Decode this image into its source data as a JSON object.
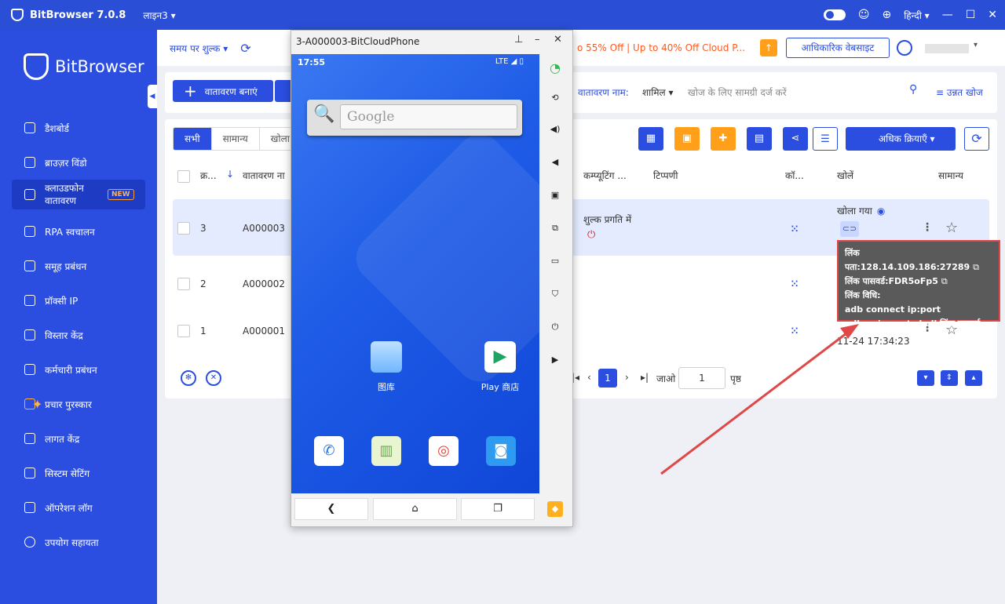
{
  "titlebar": {
    "app_name": "BitBrowser 7.0.8",
    "line": "लाइन3 ▾",
    "language": "हिन्दी ▾"
  },
  "sidebar": {
    "brand": "BitBrowser",
    "items": [
      {
        "label": "डैशबोर्ड"
      },
      {
        "label": "ब्राउज़र विंडो"
      },
      {
        "label": "क्लाउडफोन वातावरण",
        "badge": "NEW"
      },
      {
        "label": "RPA स्वचालन"
      },
      {
        "label": "समूह प्रबंधन"
      },
      {
        "label": "प्रॉक्सी IP"
      },
      {
        "label": "विस्तार केंद्र"
      },
      {
        "label": "कर्मचारी प्रबंधन"
      },
      {
        "label": "प्रचार पुरस्कार"
      },
      {
        "label": "लागत केंद्र"
      },
      {
        "label": "सिस्टम सेटिंग"
      },
      {
        "label": "ऑपरेशन लॉग"
      },
      {
        "label": "उपयोग सहायता"
      }
    ]
  },
  "topbar": {
    "pay_label": "समय पर शुल्क ▾",
    "promo": "o 55% Off | Up to 40% Off Cloud P...",
    "official_label": "आधिकारिक वेबसाइट"
  },
  "toolbar": {
    "create_label": "वातावरण बनाएं",
    "search_label": "वातावरण नाम:",
    "search_select": "शामिल ▾",
    "search_placeholder": "खोज के लिए सामग्री दर्ज करें",
    "advanced_label": "उन्नत खोज"
  },
  "tabs": [
    "सभी",
    "सामान्य",
    "खोला ग"
  ],
  "more_actions": "अधिक क्रियाएँ ▾",
  "table": {
    "headers": {
      "num": "क्र...",
      "name": "वातावरण ना",
      "billing": "कम्प्यूटिंग ...",
      "note": "टिप्पणी",
      "config": "कॉ...",
      "open": "खोलें",
      "normal": "सामान्य"
    },
    "rows": [
      {
        "num": "3",
        "name": "A000003",
        "billing": "शुल्क प्रगति में",
        "open_status": "खोला गया"
      },
      {
        "num": "2",
        "name": "A000002"
      },
      {
        "num": "1",
        "name": "A000001",
        "open_time": "11-24 17:34:23"
      }
    ]
  },
  "pagination": {
    "current": "1",
    "goto_label": "जाओ",
    "goto_value": "1",
    "page_label": "पृष्ठ"
  },
  "phone": {
    "title": "3-A000003-BitCloudPhone",
    "time": "17:55",
    "network": "LTE ◢ ▯",
    "search_text": "Google",
    "apps": [
      {
        "label": "图库"
      },
      {
        "label": "Play 商店"
      }
    ]
  },
  "tooltip": {
    "address": "लिंक पता:128.14.109.186:27289",
    "password": "लिंक पासवर्ड:FDR5oFp5",
    "method": "लिंक विधि:",
    "cmd1": "adb connect ip:port",
    "cmd2": "adb -s ip:port shell लिंक पासवर्ड"
  },
  "colors": {
    "primary": "#2b4ee0",
    "orange": "#ff9f1a",
    "annotation": "#e04848"
  }
}
